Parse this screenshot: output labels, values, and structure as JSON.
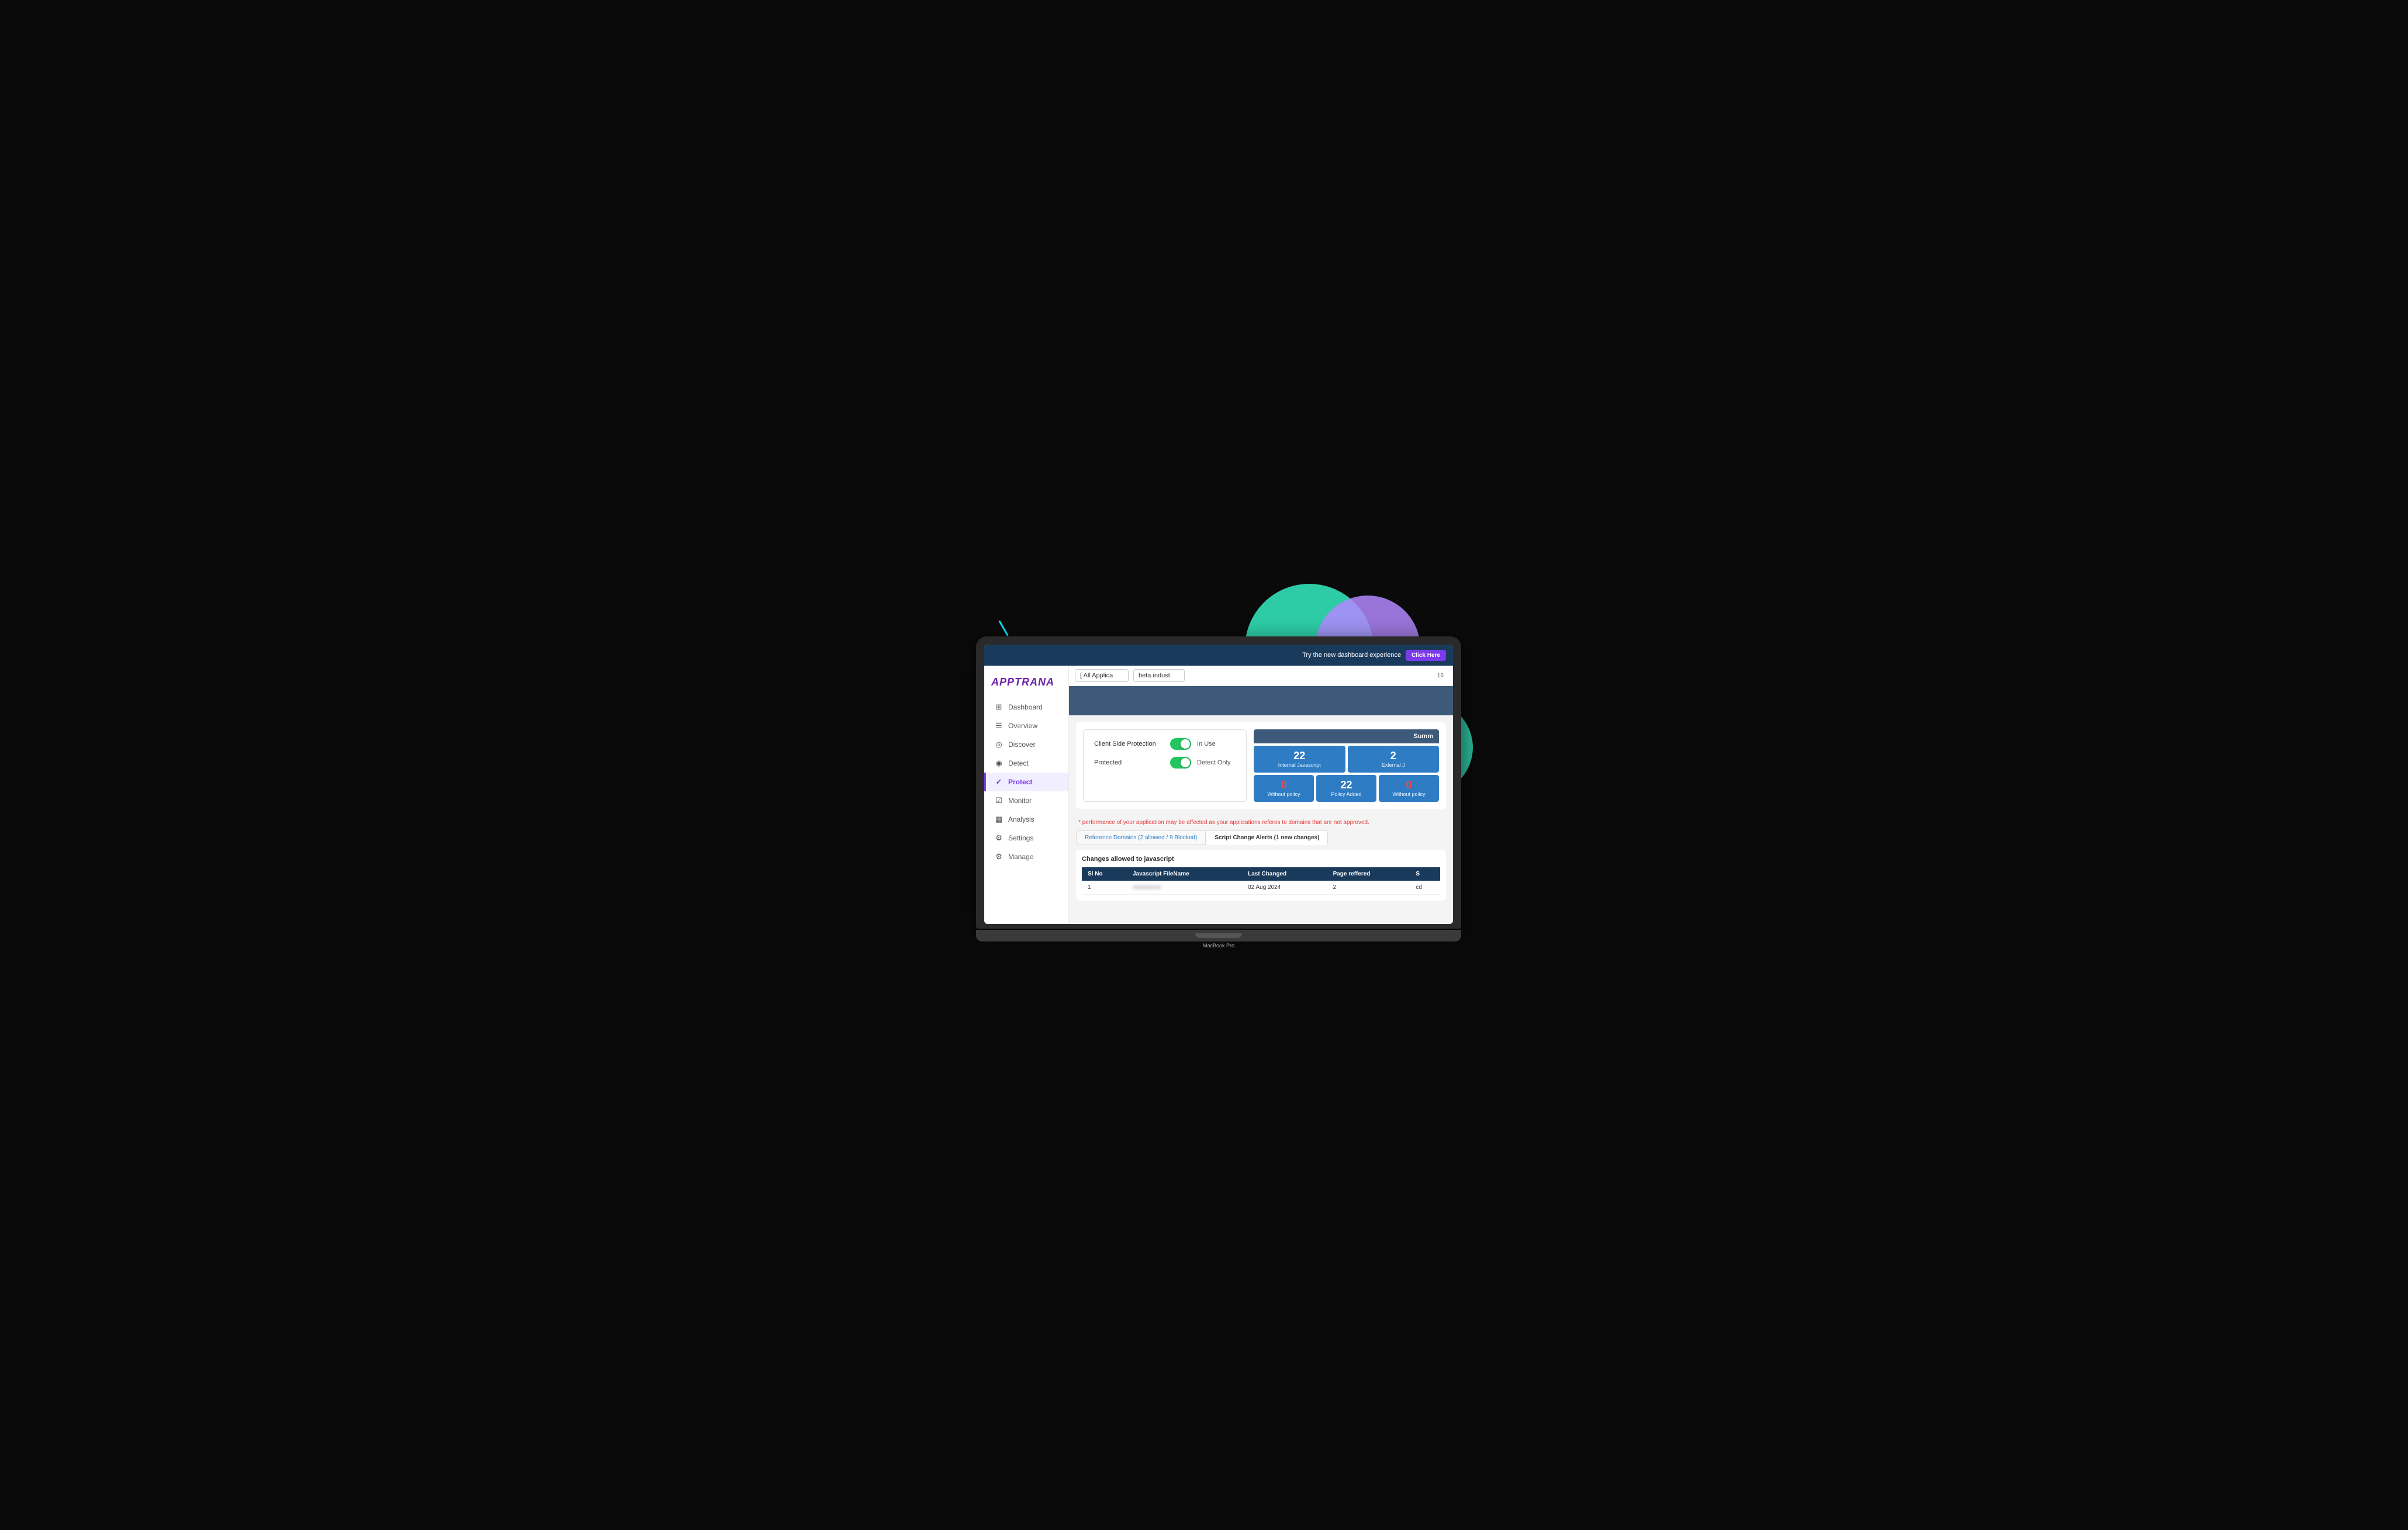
{
  "laptop": {
    "model_label": "MacBook Pro"
  },
  "banner": {
    "text": "Try the new dashboard experience",
    "button_label": "Click Here"
  },
  "dropdowns": {
    "app_placeholder": "[ All Applica",
    "domain_placeholder": "beta.indust"
  },
  "sidebar": {
    "logo": "APPTRANA",
    "items": [
      {
        "id": "dashboard",
        "label": "Dashboard",
        "icon": "⊞",
        "active": false
      },
      {
        "id": "overview",
        "label": "Overview",
        "icon": "☰",
        "active": false
      },
      {
        "id": "discover",
        "label": "Discover",
        "icon": "◎",
        "active": false
      },
      {
        "id": "detect",
        "label": "Detect",
        "icon": "◉",
        "active": false
      },
      {
        "id": "protect",
        "label": "Protect",
        "icon": "✓",
        "active": true
      },
      {
        "id": "monitor",
        "label": "Monitor",
        "icon": "☑",
        "active": false
      },
      {
        "id": "analysis",
        "label": "Analysis",
        "icon": "▦",
        "active": false
      },
      {
        "id": "settings",
        "label": "Settings",
        "icon": "⚙",
        "active": false
      },
      {
        "id": "manage",
        "label": "Manage",
        "icon": "⚙",
        "active": false
      }
    ]
  },
  "protection": {
    "client_side_label": "Client Side Protection",
    "in_use_label": "In Use",
    "protected_label": "Protected",
    "detect_only_label": "Detect Only"
  },
  "summary": {
    "header": "Summ",
    "stats": [
      {
        "number": "22",
        "label": "Internal Javascript",
        "color": "blue"
      },
      {
        "number": "2",
        "label": "External J",
        "color": "blue"
      },
      {
        "number": "0",
        "label": "Without policy",
        "color": "red"
      },
      {
        "number": "22",
        "label": "Policy Added",
        "color": "blue"
      },
      {
        "number": "0",
        "label": "Without policy",
        "color": "red"
      }
    ]
  },
  "warning": {
    "text": "* performance of your application may be affected as your applications referes to domains that are not approved."
  },
  "tabs": [
    {
      "id": "reference-domains",
      "label": "Reference Domains (2 allowed / 9 Blocked)",
      "active": false
    },
    {
      "id": "script-change-alerts",
      "label": "Script Change Alerts (1 new changes)",
      "active": true
    }
  ],
  "table": {
    "title": "Changes allowed to javascript",
    "columns": [
      "Sl No",
      "Javascript FileName",
      "Last Changed",
      "Page reffered",
      "S"
    ],
    "rows": [
      {
        "sl_no": "1",
        "filename": "●●●●●●●●",
        "last_changed": "02 Aug 2024",
        "page_reffered": "2",
        "s": "cd"
      }
    ]
  },
  "page_number": "16"
}
